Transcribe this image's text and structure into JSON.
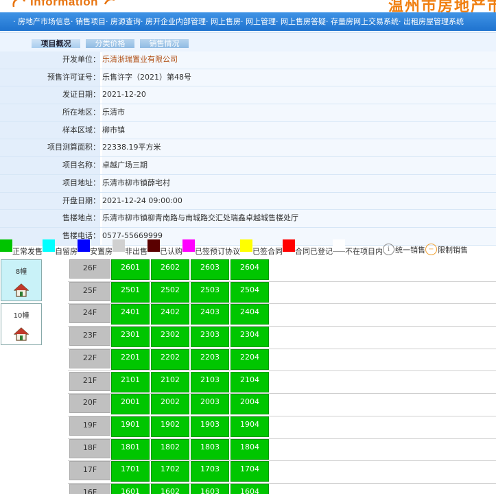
{
  "header": {
    "logo_text": "Information",
    "slogan": "温州市房地产市"
  },
  "nav": {
    "items": [
      "· 房地产市场信息",
      "· 销售项目",
      "· 房源查询",
      "· 房开企业内部管理",
      "· 网上售房",
      "· 网上管理",
      "· 网上售房答疑",
      "· 存量房网上交易系统",
      "· 出租房屋管理系统"
    ]
  },
  "tabs": [
    {
      "label": "项目概况",
      "active": true
    },
    {
      "label": "分类价格",
      "active": false
    },
    {
      "label": "销售情况",
      "active": false
    }
  ],
  "project_info": [
    {
      "label": "开发单位：",
      "value": "乐清浙瑞置业有限公司",
      "link": true
    },
    {
      "label": "预售许可证号：",
      "value": "乐售许字（2021）第48号",
      "link": false
    },
    {
      "label": "发证日期：",
      "value": "2021-12-20",
      "link": false
    },
    {
      "label": "所在地区：",
      "value": "乐清市",
      "link": false
    },
    {
      "label": "样本区域：",
      "value": "柳市镇",
      "link": false
    },
    {
      "label": "项目测算面积：",
      "value": "22338.19平方米",
      "link": false
    },
    {
      "label": "项目名称：",
      "value": "卓越广场三期",
      "link": false
    },
    {
      "label": "项目地址：",
      "value": "乐清市柳市镇薛宅村",
      "link": false
    },
    {
      "label": "开盘日期：",
      "value": "2021-12-24 09:00:00",
      "link": false
    },
    {
      "label": "售楼地点：",
      "value": "乐清市柳市镇柳青南路与南城路交汇处瑞鑫卓越城售楼处厅",
      "link": false
    },
    {
      "label": "售楼电话：",
      "value": "0577-55669999",
      "link": false
    }
  ],
  "legend": [
    {
      "label": "正常发售",
      "color": "#00c400",
      "type": "swatch"
    },
    {
      "label": "自留房",
      "color": "#00ffff",
      "type": "swatch"
    },
    {
      "label": "安置房",
      "color": "#0000ff",
      "type": "swatch"
    },
    {
      "label": "非出售",
      "color": "#d0d0d0",
      "type": "swatch"
    },
    {
      "label": "已认购",
      "color": "#5a0000",
      "type": "swatch"
    },
    {
      "label": "已签预订协议",
      "color": "#ff00ff",
      "type": "swatch"
    },
    {
      "label": "已签合同",
      "color": "#ffff00",
      "type": "swatch"
    },
    {
      "label": "合同已登记",
      "color": "#ff0000",
      "type": "swatch"
    },
    {
      "label": "不在项目内",
      "color": "#ffffff",
      "type": "blank"
    },
    {
      "label": "统一销售",
      "color": "#888888",
      "type": "info"
    },
    {
      "label": "限制销售",
      "color": "#f0a030",
      "type": "restrict"
    }
  ],
  "buildings": [
    {
      "name": "8幢",
      "selected": true
    },
    {
      "name": "10幢",
      "selected": false
    }
  ],
  "floors": [
    {
      "floor": "26F",
      "units": [
        "2601",
        "2602",
        "2603",
        "2604"
      ]
    },
    {
      "floor": "25F",
      "units": [
        "2501",
        "2502",
        "2503",
        "2504"
      ]
    },
    {
      "floor": "24F",
      "units": [
        "2401",
        "2402",
        "2403",
        "2404"
      ]
    },
    {
      "floor": "23F",
      "units": [
        "2301",
        "2302",
        "2303",
        "2304"
      ]
    },
    {
      "floor": "22F",
      "units": [
        "2201",
        "2202",
        "2203",
        "2204"
      ]
    },
    {
      "floor": "21F",
      "units": [
        "2101",
        "2102",
        "2103",
        "2104"
      ]
    },
    {
      "floor": "20F",
      "units": [
        "2001",
        "2002",
        "2003",
        "2004"
      ]
    },
    {
      "floor": "19F",
      "units": [
        "1901",
        "1902",
        "1903",
        "1904"
      ]
    },
    {
      "floor": "18F",
      "units": [
        "1801",
        "1802",
        "1803",
        "1804"
      ]
    },
    {
      "floor": "17F",
      "units": [
        "1701",
        "1702",
        "1703",
        "1704"
      ]
    },
    {
      "floor": "16F",
      "units": [
        "1601",
        "1602",
        "1603",
        "1604"
      ]
    }
  ]
}
